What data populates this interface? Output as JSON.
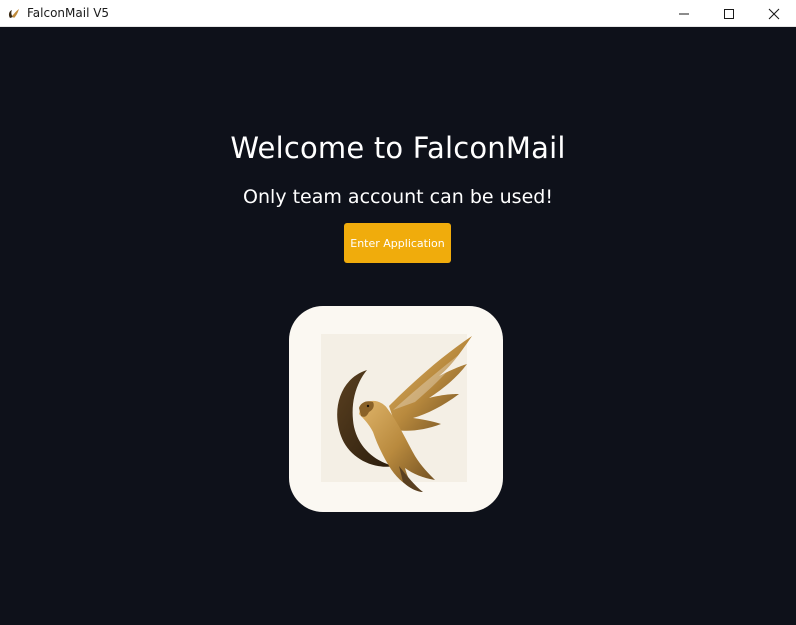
{
  "window": {
    "title": "FalconMail V5",
    "controls": {
      "minimize_icon": "minimize-icon",
      "maximize_icon": "maximize-icon",
      "close_icon": "close-icon"
    }
  },
  "main": {
    "heading": "Welcome to FalconMail",
    "subheading": "Only team account can be used!",
    "enter_button_label": "Enter Application",
    "logo_icon": "falcon-logo-icon"
  },
  "colors": {
    "background": "#0e111a",
    "accent": "#f0ac0c",
    "logo_card": "#fbf8f2",
    "falcon_gold": "#b98a3e",
    "falcon_dark": "#3a2a14"
  }
}
